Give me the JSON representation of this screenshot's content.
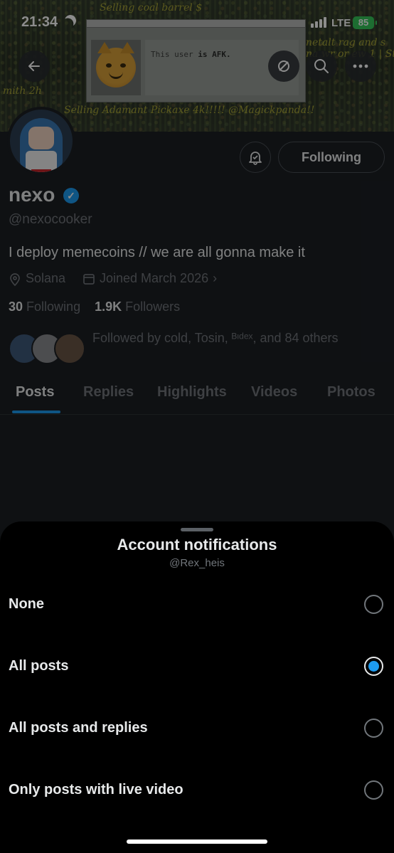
{
  "status_bar": {
    "time": "21:34",
    "network": "LTE",
    "battery": "85"
  },
  "banner": {
    "game_text_top": "Selling coal barrel $",
    "game_text_right1": "netalt rag and s",
    "game_text_right2": "na wr or ew 1 | St",
    "game_text_left": "mith 2h",
    "game_text_bottom": "Selling Adamant Pickaxe 4k!!!!! @Magickpanda!!",
    "afk_prefix": "This user",
    "afk_is": "is AFK."
  },
  "icons": {
    "back": "back-arrow-icon",
    "search": "search-icon",
    "more": "more-icon",
    "bell": "bell-icon",
    "verified": "verified-badge-icon",
    "location": "location-icon",
    "calendar": "calendar-icon"
  },
  "profile": {
    "display_name": "nexo",
    "handle": "@nexocooker",
    "bio": "I deploy memecoins // we are all gonna make it",
    "location": "Solana",
    "joined": "Joined March 2026",
    "following_count": "30",
    "following_label": "Following",
    "followers_count": "1.9K",
    "followers_label": "Followers",
    "followed_by": "Followed by cold, Tosin, ᴮᶦᵈᵉˣ, and 84 others",
    "follow_button": "Following"
  },
  "tabs": [
    "Posts",
    "Replies",
    "Highlights",
    "Videos",
    "Photos"
  ],
  "sheet": {
    "title": "Account notifications",
    "subtitle": "@Rex_heis",
    "options": [
      {
        "label": "None",
        "selected": false
      },
      {
        "label": "All posts",
        "selected": true
      },
      {
        "label": "All posts and replies",
        "selected": false
      },
      {
        "label": "Only posts with live video",
        "selected": false
      }
    ]
  },
  "colors": {
    "accent": "#1d9bf0",
    "background": "#1c1f24",
    "sheet": "#000000",
    "muted_text": "#71767b",
    "battery": "#35c759"
  }
}
